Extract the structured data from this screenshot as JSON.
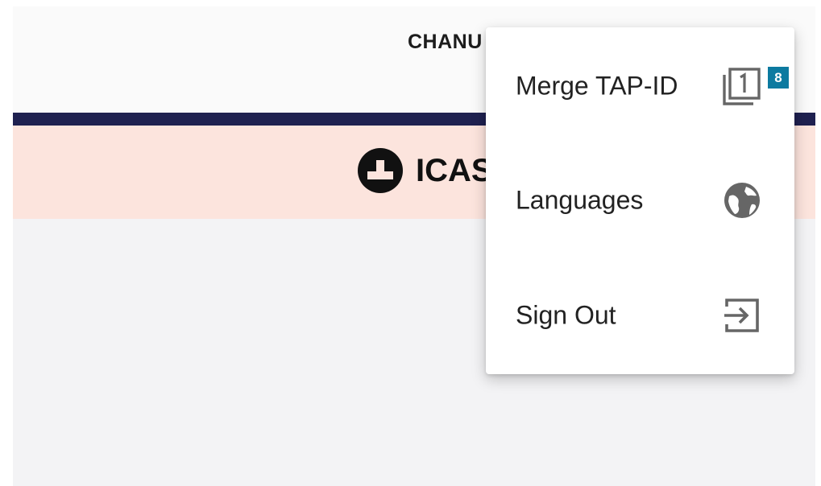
{
  "header": {
    "user_name": "CHANU"
  },
  "brand": {
    "name": "ICAS",
    "bar_color": "#fce4dd",
    "navy_color": "#1f2150"
  },
  "menu": {
    "items": [
      {
        "label": "Merge TAP-ID",
        "icon": "filter-1-icon"
      },
      {
        "label": "Languages",
        "icon": "globe-icon"
      },
      {
        "label": "Sign Out",
        "icon": "sign-out-icon"
      }
    ],
    "badge": {
      "count": "8",
      "color": "#0c7aa0"
    }
  }
}
